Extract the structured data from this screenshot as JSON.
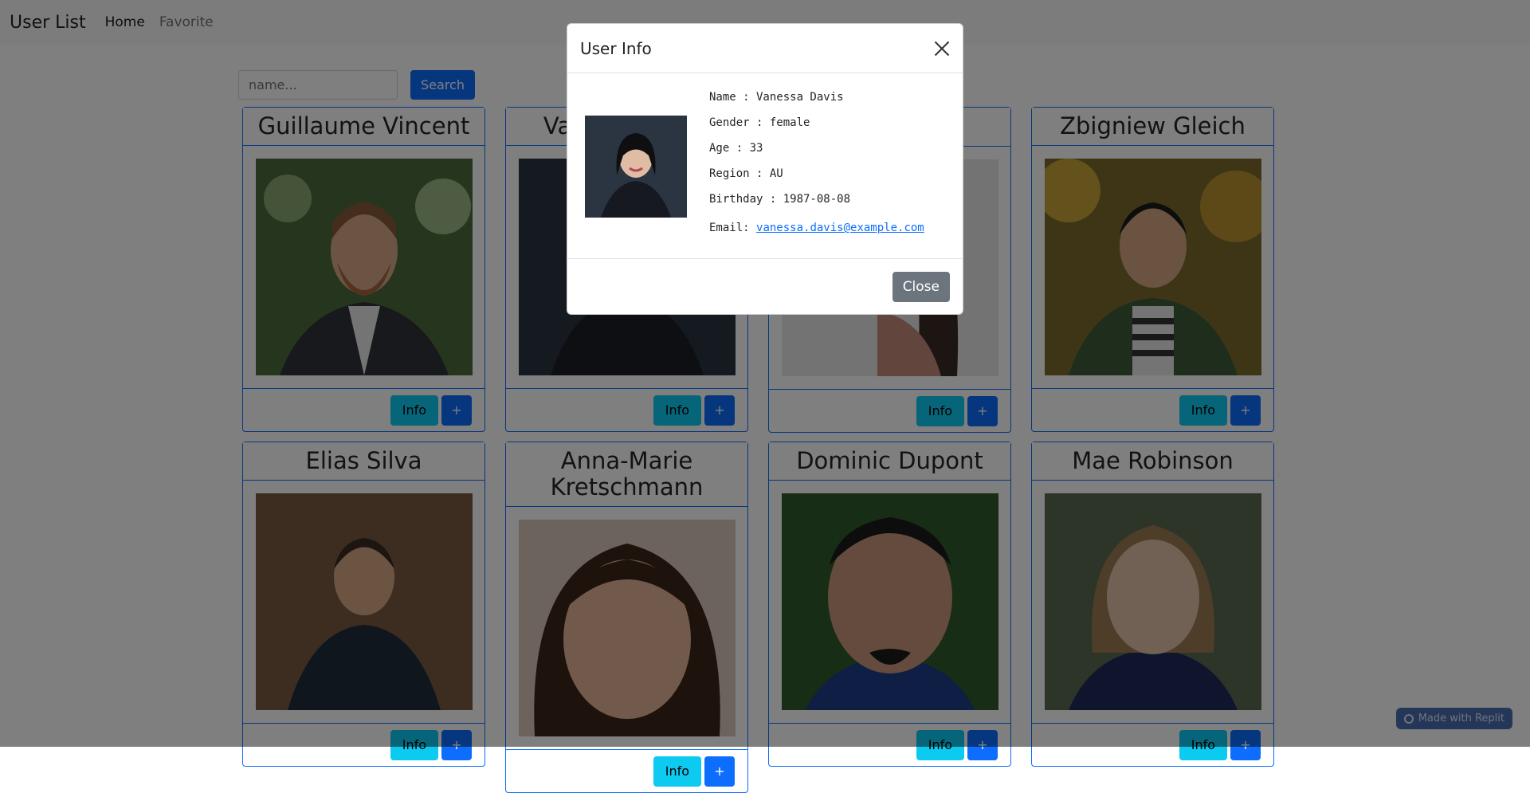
{
  "navbar": {
    "brand": "User List",
    "links": [
      {
        "label": "Home",
        "active": true
      },
      {
        "label": "Favorite",
        "active": false
      }
    ]
  },
  "search": {
    "placeholder": "name...",
    "button_label": "Search"
  },
  "cards": [
    {
      "name": "Guillaume Vincent",
      "info_label": "Info",
      "add_label": "+"
    },
    {
      "name": "Vanessa Davis",
      "info_label": "Info",
      "add_label": "+"
    },
    {
      "name": "",
      "info_label": "Info",
      "add_label": "+"
    },
    {
      "name": "Zbigniew Gleich",
      "info_label": "Info",
      "add_label": "+"
    },
    {
      "name": "Elias Silva",
      "info_label": "Info",
      "add_label": "+"
    },
    {
      "name": "Anna-Marie Kretschmann",
      "info_label": "Info",
      "add_label": "+"
    },
    {
      "name": "Dominic Dupont",
      "info_label": "Info",
      "add_label": "+"
    },
    {
      "name": "Mae Robinson",
      "info_label": "Info",
      "add_label": "+"
    }
  ],
  "modal": {
    "title": "User Info",
    "name_line": "Name : Vanessa Davis",
    "gender_line": "Gender : female",
    "age_line": "Age : 33",
    "region_line": "Region : AU",
    "birthday_line": "Birthday : 1987-08-08",
    "email_label": "Email: ",
    "email": "vanessa.davis@example.com",
    "close_label": "Close"
  },
  "badge": {
    "label": "Made with Replit"
  },
  "colors": {
    "primary": "#0d6efd",
    "info": "#0dcaf0",
    "secondary": "#6c757d"
  }
}
